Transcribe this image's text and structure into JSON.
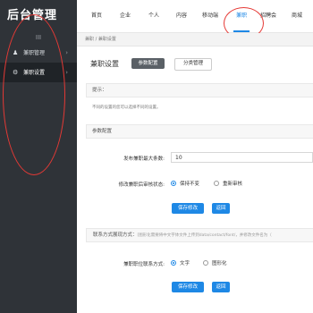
{
  "sidebar": {
    "logo": "后台管理",
    "collapse": "III",
    "items": [
      {
        "label": "兼职管理",
        "icon": "user-icon"
      },
      {
        "label": "兼职设置",
        "icon": "gear-icon"
      }
    ]
  },
  "topnav": [
    {
      "label": "首页"
    },
    {
      "label": "企业"
    },
    {
      "label": "个人"
    },
    {
      "label": "内容"
    },
    {
      "label": "移动端"
    },
    {
      "label": "兼职"
    },
    {
      "label": "招聘会"
    },
    {
      "label": "商城"
    }
  ],
  "breadcrumb": "兼职 / 兼职设置",
  "page": {
    "title": "兼职设置",
    "tabs": [
      "参数配置",
      "分类管理"
    ]
  },
  "tips": {
    "head": "提示：",
    "text": "不同的设置的您可以选择不同的设置。"
  },
  "config": {
    "head": "参数配置",
    "max_label": "发布兼职最大条数:",
    "max_value": "10",
    "audit_label": "修改兼职后审核状态:",
    "audit_options": [
      "保持不变",
      "重新审核"
    ],
    "audit_selected": 0,
    "save": "保存修改",
    "back": "返回"
  },
  "contact": {
    "head": "联系方式展现方式：",
    "note": "[图形化需要将中文字体文件上传到data/contact/font/，并修改文件名为（",
    "label": "兼职职位联系方式:",
    "options": [
      "文字",
      "图形化"
    ],
    "selected": 0,
    "save": "保存修改",
    "back": "返回"
  },
  "colors": {
    "accent": "#1e88e5",
    "sidebar": "#2f3338",
    "annotation": "#e53935"
  }
}
